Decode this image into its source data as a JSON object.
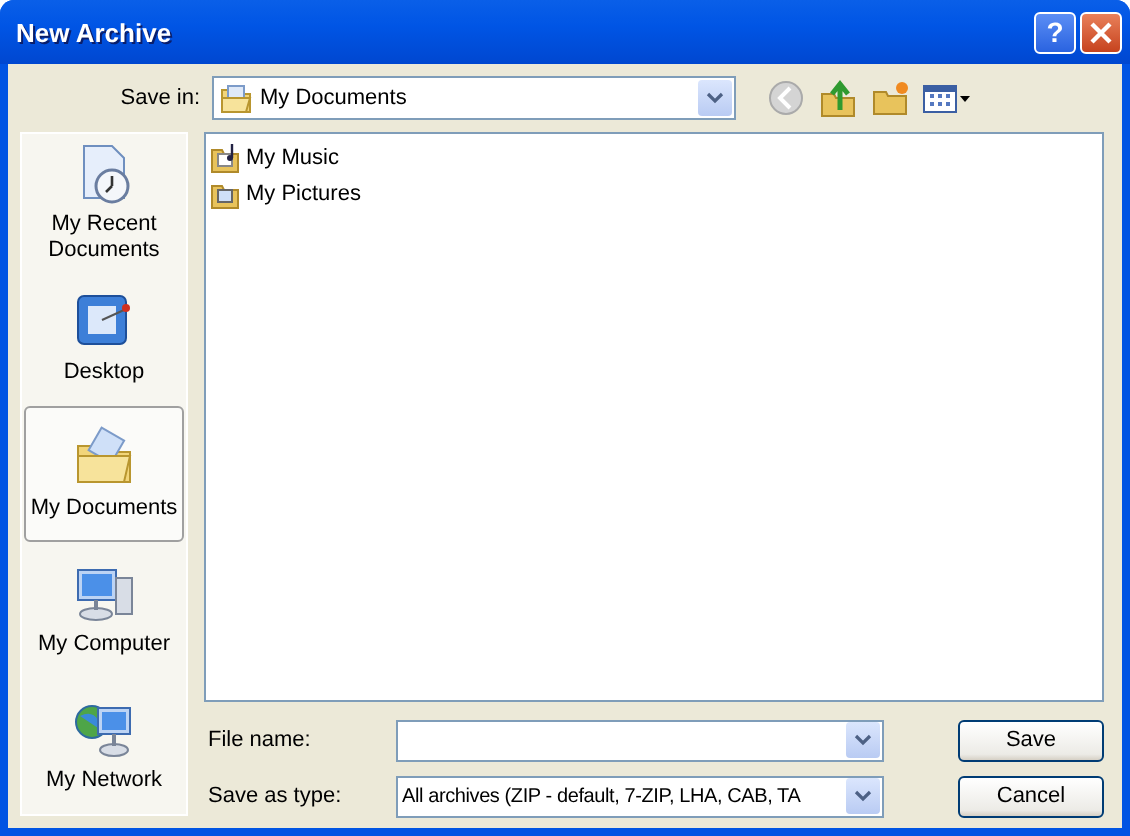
{
  "window": {
    "title": "New Archive"
  },
  "title_buttons": [
    {
      "kind": "help",
      "label": "?"
    },
    {
      "kind": "close"
    }
  ],
  "save_in": {
    "label": "Save in:",
    "value": "My Documents"
  },
  "toolbar": [
    {
      "kind": "back",
      "disabled": true
    },
    {
      "kind": "up",
      "disabled": false
    },
    {
      "kind": "newfolder",
      "disabled": false
    },
    {
      "kind": "views",
      "disabled": false
    }
  ],
  "places": [
    {
      "kind": "recent",
      "label": "My Recent Documents",
      "selected": false
    },
    {
      "kind": "desktop",
      "label": "Desktop",
      "selected": false
    },
    {
      "kind": "documents",
      "label": "My Documents",
      "selected": true
    },
    {
      "kind": "computer",
      "label": "My Computer",
      "selected": false
    },
    {
      "kind": "network",
      "label": "My Network",
      "selected": false
    }
  ],
  "files": [
    {
      "kind": "music",
      "name": "My Music"
    },
    {
      "kind": "pictures",
      "name": "My Pictures"
    }
  ],
  "file_name": {
    "label": "File name:"
  },
  "save_as_type": {
    "label": "Save as type:",
    "value": "All archives (ZIP - default, 7-ZIP, LHA, CAB, TA"
  },
  "buttons": [
    "Save",
    "Cancel"
  ]
}
